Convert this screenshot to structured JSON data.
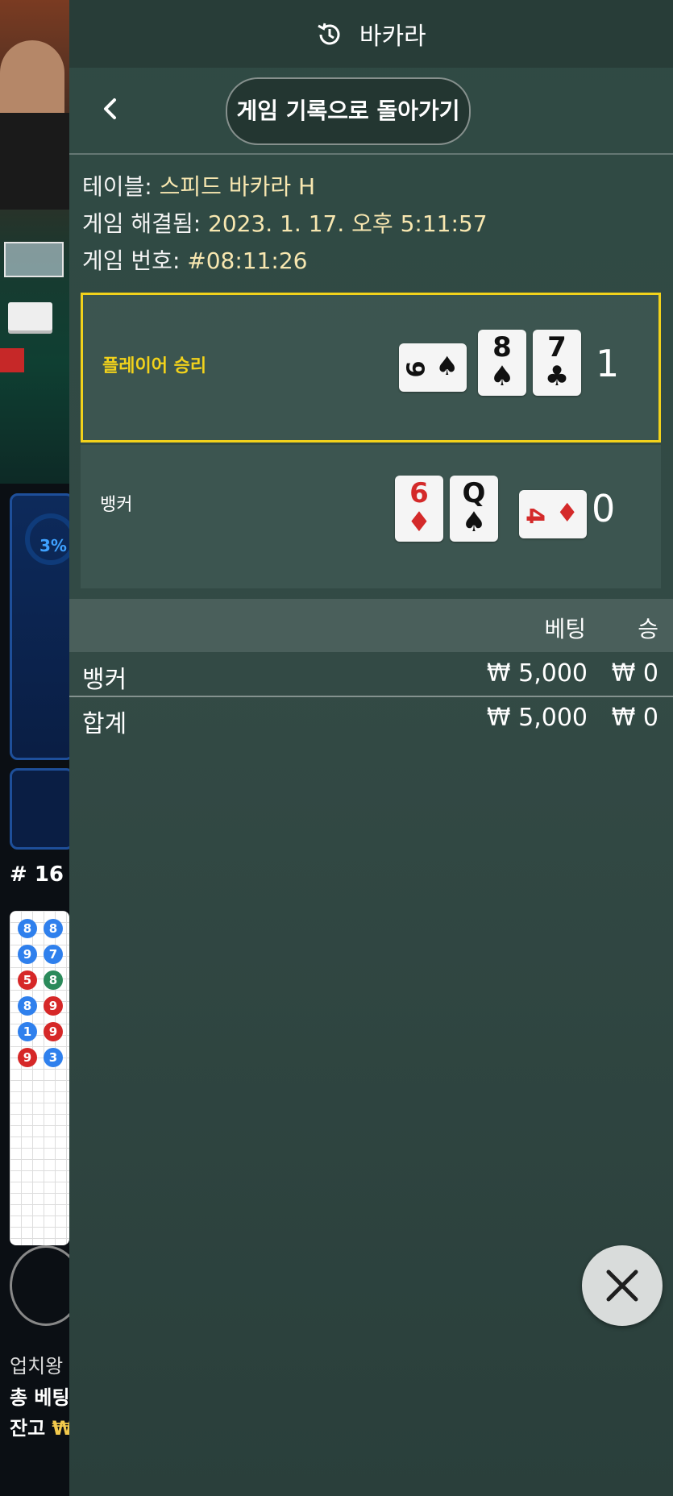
{
  "header": {
    "title": "바카라",
    "icon": "history-icon"
  },
  "nav": {
    "back_label": "게임 기록으로 돌아가기"
  },
  "info": {
    "table_label": "테이블:",
    "table_value": "스피드 바카라 H",
    "resolved_label": "게임 해결됨:",
    "resolved_value": "2023. 1. 17. 오후 5:11:57",
    "number_label": "게임 번호:",
    "number_value": "#08:11:26"
  },
  "player_result": {
    "label": "플레이어 승리",
    "cards": [
      {
        "rank": "9",
        "suit": "♠",
        "color": "black",
        "orientation": "sideways"
      },
      {
        "rank": "8",
        "suit": "♠",
        "color": "black"
      },
      {
        "rank": "7",
        "suit": "♣",
        "color": "black"
      }
    ],
    "score": "1"
  },
  "banker_result": {
    "label": "뱅커",
    "cards": [
      {
        "rank": "6",
        "suit": "♦",
        "color": "red"
      },
      {
        "rank": "Q",
        "suit": "♠",
        "color": "black"
      },
      {
        "rank": "4",
        "suit": "♦",
        "color": "red",
        "orientation": "sideways"
      }
    ],
    "score": "0"
  },
  "bets_table": {
    "headers": {
      "bet": "베팅",
      "win": "승"
    },
    "rows": [
      {
        "name": "뱅커",
        "bet": "₩ 5,000",
        "win": "₩ 0"
      }
    ],
    "total": {
      "name": "합계",
      "bet": "₩ 5,000",
      "win": "₩ 0"
    }
  },
  "background": {
    "progress_pct": "3%",
    "shoe_number": "# 16",
    "partial_player_label": "업치왕",
    "total_bet_label": "총 베팅",
    "balance_label": "잔고",
    "balance_currency": "₩"
  },
  "colors": {
    "accent_yellow": "#f2d21b",
    "panel": "#334a45",
    "banker_red": "#d42a2a",
    "player_blue": "#2f80ed"
  }
}
